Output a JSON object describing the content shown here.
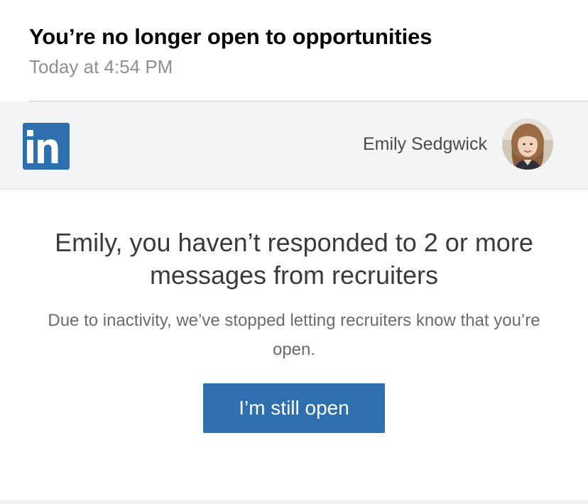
{
  "email": {
    "subject": "You’re no longer open to opportunities",
    "timestamp": "Today at 4:54 PM"
  },
  "linkedin_bar": {
    "logo_icon": "linkedin-logo",
    "logo_text": "in",
    "user_name": "Emily Sedgwick",
    "avatar_icon": "user-avatar"
  },
  "message": {
    "headline": "Emily, you haven’t responded to 2 or more messages from recruiters",
    "description": "Due to inactivity, we’ve stopped letting recruiters know that you’re open.",
    "button_label": "I’m still open"
  },
  "colors": {
    "brand_blue": "#2e6fad",
    "bar_background": "#f3f4f6",
    "timestamp_gray": "#8e8e93"
  }
}
